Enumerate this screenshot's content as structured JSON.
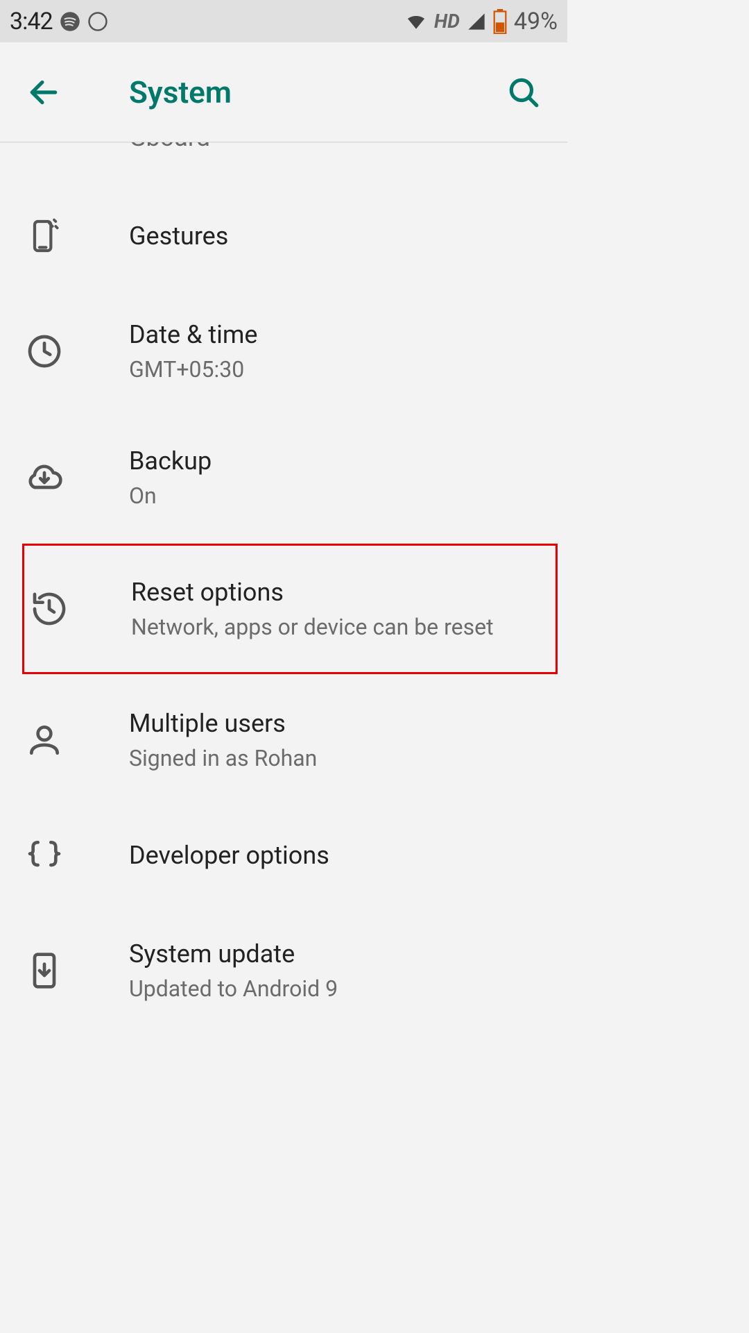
{
  "status": {
    "time": "3:42",
    "hd": "HD",
    "battery_pct": "49%"
  },
  "appbar": {
    "title": "System"
  },
  "peek": {
    "subtitle": "Gboard"
  },
  "items": [
    {
      "title": "Gestures",
      "subtitle": ""
    },
    {
      "title": "Date & time",
      "subtitle": "GMT+05:30"
    },
    {
      "title": "Backup",
      "subtitle": "On"
    },
    {
      "title": "Reset options",
      "subtitle": "Network, apps or device can be reset"
    },
    {
      "title": "Multiple users",
      "subtitle": "Signed in as Rohan"
    },
    {
      "title": "Developer options",
      "subtitle": ""
    },
    {
      "title": "System update",
      "subtitle": "Updated to Android 9"
    }
  ]
}
